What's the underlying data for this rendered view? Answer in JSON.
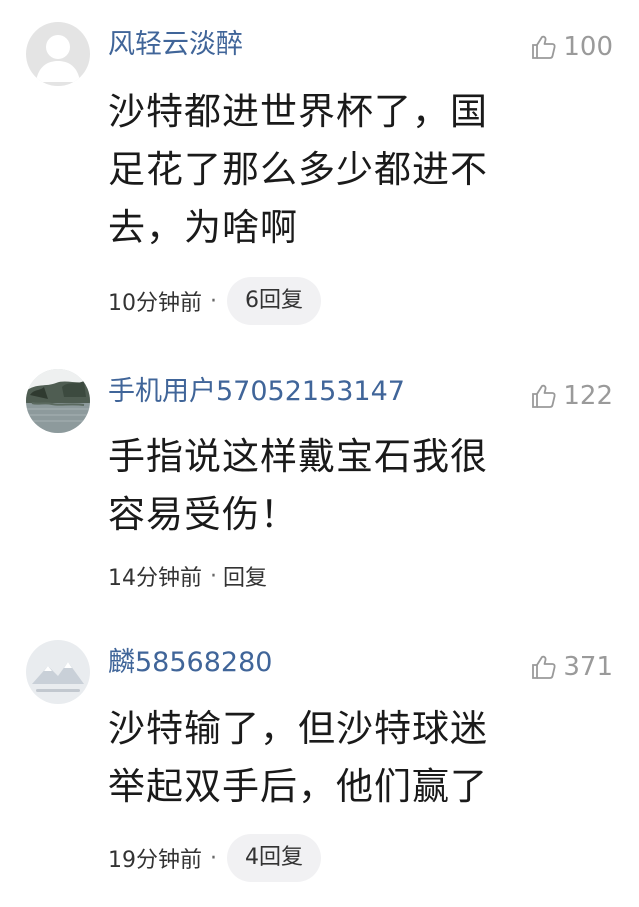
{
  "comments": [
    {
      "username": "风轻云淡醉",
      "likes": "100",
      "lines": [
        "沙特都进世界杯了，国",
        "足花了那么多少都进不",
        "去，为啥啊"
      ],
      "time": "10分钟前",
      "separator": "·",
      "reply": "6回复",
      "avatar_icon": "default-user-avatar"
    },
    {
      "username": "手机用户57052153147",
      "likes": "122",
      "lines": [
        "手指说这样戴宝石我很",
        "容易受伤！"
      ],
      "time": "14分钟前",
      "separator": "·",
      "reply": "回复",
      "avatar_icon": "landscape-photo-avatar"
    },
    {
      "username": "麟58568280",
      "likes": "371",
      "lines": [
        "沙特输了，但沙特球迷",
        "举起双手后，他们赢了"
      ],
      "time": "19分钟前",
      "separator": "·",
      "reply": "4回复",
      "avatar_icon": "mountain-logo-avatar"
    }
  ],
  "colors": {
    "username": "#406599",
    "like": "#9a9a9a",
    "reply_pill_bg": "#f1f1f3"
  },
  "icons": {
    "like": "thumbs-up-icon"
  }
}
